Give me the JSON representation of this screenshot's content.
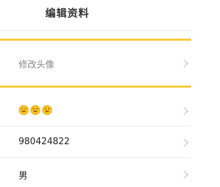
{
  "header": {
    "title": "编辑资料"
  },
  "avatar_row": {
    "label": "修改头像"
  },
  "nickname_row": {
    "smileys": [
      "smiley-icon",
      "smiley-icon",
      "smiley-icon"
    ]
  },
  "id_row": {
    "value": "980424822"
  },
  "gender_row": {
    "value": "男"
  },
  "colors": {
    "accent": "#f7c936",
    "divider": "#ececec"
  }
}
